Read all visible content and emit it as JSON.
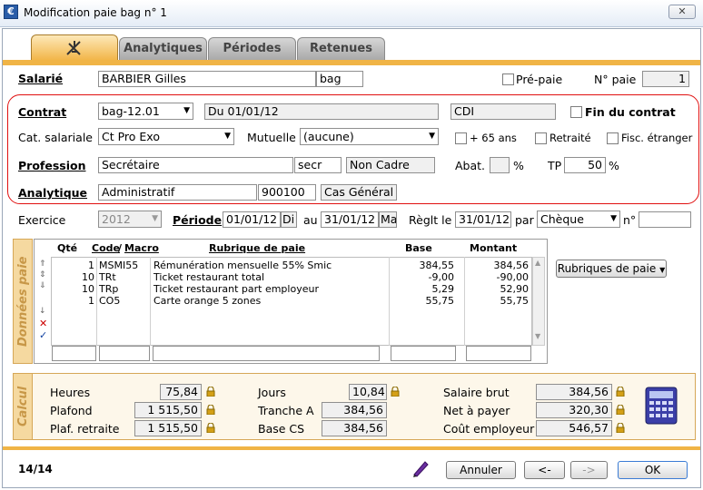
{
  "window": {
    "title": "Modification paie bag n° 1",
    "close": "✕",
    "app_icon": "€"
  },
  "tabs": [
    {
      "label": ""
    },
    {
      "label": "Analytiques"
    },
    {
      "label": "Périodes"
    },
    {
      "label": "Retenues"
    }
  ],
  "salarie": {
    "label": "Salarié",
    "name": "BARBIER Gilles",
    "code": "bag",
    "prepaie_label": "Pré-paie",
    "npaie_label": "N° paie",
    "npaie": "1"
  },
  "contrat": {
    "label": "Contrat",
    "value": "bag-12.01",
    "date": "Du 01/01/12",
    "type": "CDI",
    "fin_label": "Fin du contrat"
  },
  "cat": {
    "label": "Cat. salariale",
    "value": "Ct Pro Exo",
    "mutuelle_label": "Mutuelle",
    "mutuelle": "(aucune)",
    "plus65": "+ 65 ans",
    "retraite": "Retraité",
    "fisc": "Fisc. étranger"
  },
  "profession": {
    "label": "Profession",
    "value": "Secrétaire",
    "code": "secr",
    "statut": "Non Cadre",
    "abat_label": "Abat.",
    "abat": "",
    "pct1": "%",
    "tp_label": "TP",
    "tp": "50",
    "pct2": "%"
  },
  "analytique": {
    "label": "Analytique",
    "value": "Administratif",
    "code": "900100",
    "cas": "Cas Général"
  },
  "periode": {
    "exercice_label": "Exercice",
    "exercice": "2012",
    "periode_label": "Période",
    "debut": "01/01/12",
    "debut_day": "Di",
    "au_label": "au",
    "fin": "31/01/12",
    "fin_day": "Ma",
    "reglt_label": "Règlt le",
    "reglt": "31/01/12",
    "par_label": "par",
    "par": "Chèque",
    "no_label": "n°",
    "no": ""
  },
  "donnees": {
    "side_label": "Données paie",
    "headers": {
      "qte": "Qté",
      "code": "Code",
      "macro": "Macro",
      "rubrique": "Rubrique de paie",
      "base": "Base",
      "montant": "Montant"
    },
    "rows": [
      {
        "qte": "1",
        "code": "MSMI55",
        "rubrique": "Rémunération mensuelle 55% Smic",
        "base": "384,55",
        "montant": "384,56"
      },
      {
        "qte": "10",
        "code": "TRt",
        "rubrique": "Ticket restaurant total",
        "base": "-9,00",
        "montant": "-90,00"
      },
      {
        "qte": "10",
        "code": "TRp",
        "rubrique": "Ticket restaurant part employeur",
        "base": "5,29",
        "montant": "52,90"
      },
      {
        "qte": "1",
        "code": "CO5",
        "rubrique": "Carte orange 5 zones",
        "base": "55,75",
        "montant": "55,75"
      }
    ],
    "rubriques_button": "Rubriques de paie"
  },
  "calcul": {
    "side_label": "Calcul",
    "heures_label": "Heures",
    "heures": "75,84",
    "plafond_label": "Plafond",
    "plafond": "1 515,50",
    "plafret_label": "Plaf. retraite",
    "plafret": "1 515,50",
    "jours_label": "Jours",
    "jours": "10,84",
    "trancheA_label": "Tranche A",
    "trancheA": "384,56",
    "basecs_label": "Base CS",
    "basecs": "384,56",
    "brut_label": "Salaire brut",
    "brut": "384,56",
    "net_label": "Net à payer",
    "net": "320,30",
    "cout_label": "Coût employeur",
    "cout": "546,57"
  },
  "footer": {
    "counter": "14/14",
    "annuler": "Annuler",
    "prev": "<-",
    "next": "->",
    "ok": "OK"
  },
  "colors": {
    "accent": "#f0b446",
    "red": "#e01010",
    "side": "#f5d9a0"
  }
}
